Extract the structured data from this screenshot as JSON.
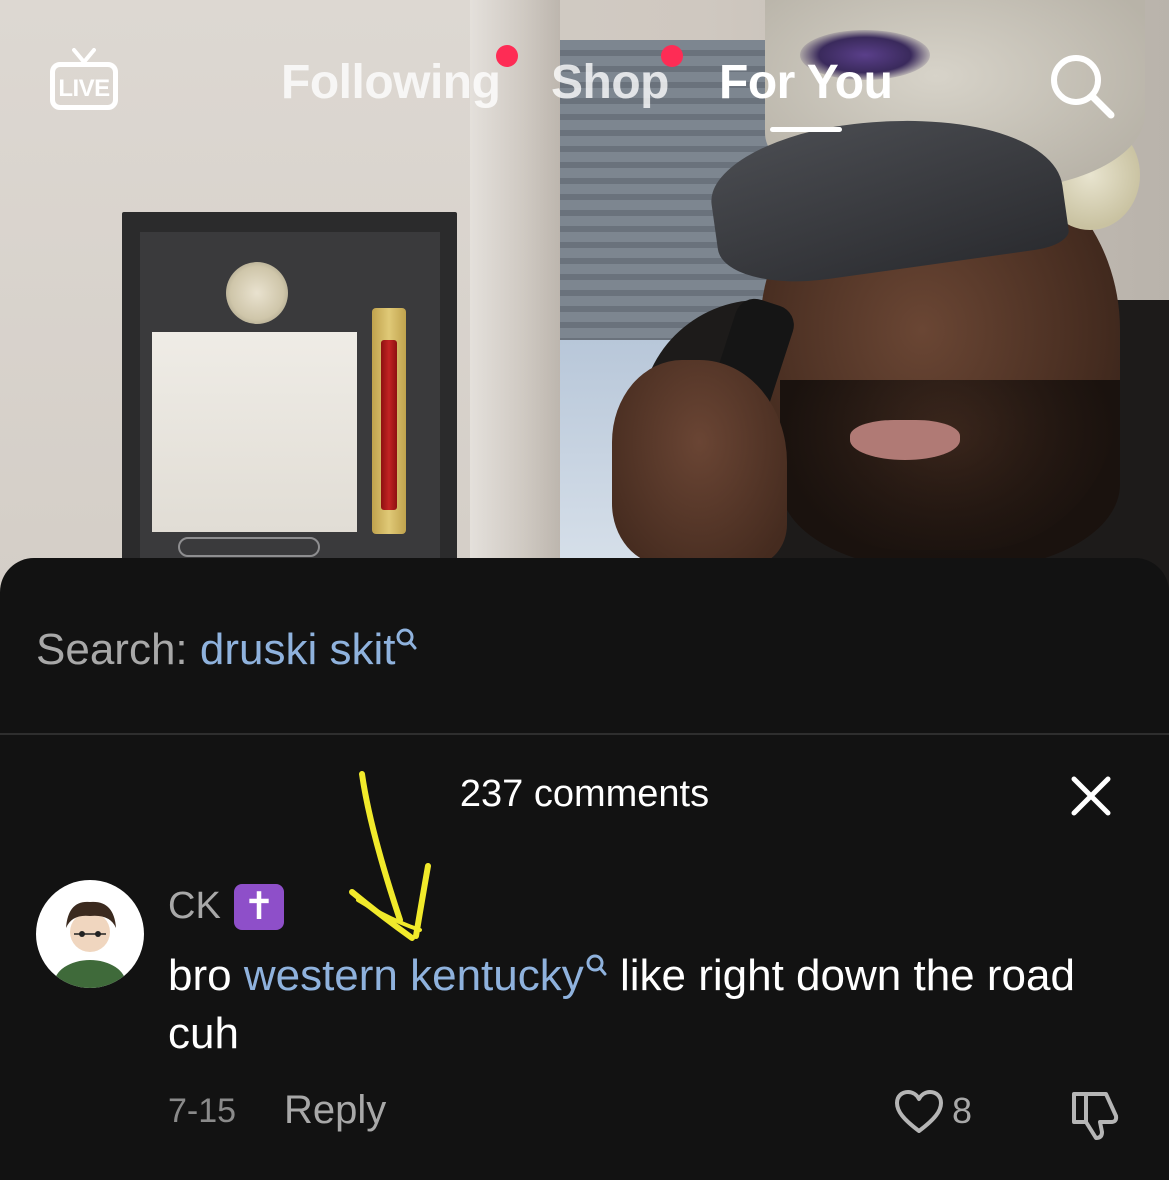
{
  "top_nav": {
    "live_label": "LIVE",
    "tabs": [
      {
        "label": "Following",
        "has_dot": true
      },
      {
        "label": "Shop",
        "has_dot": true
      },
      {
        "label": "For You",
        "active": true
      }
    ]
  },
  "search_bar": {
    "prefix": "Search: ",
    "term": "druski skit"
  },
  "comments_panel": {
    "count_label": "237 comments",
    "comments": [
      {
        "username": "CK",
        "badge": "✝",
        "text_before": "bro ",
        "link_text": "western kentucky",
        "text_after": " like right down the road cuh",
        "date": "7-15",
        "reply_label": "Reply",
        "likes": "8"
      }
    ]
  },
  "colors": {
    "accent_link": "#8fb2dd",
    "notification_dot": "#fe2c55",
    "sheet_bg": "#121212",
    "annotation_arrow": "#f1ea2b"
  }
}
